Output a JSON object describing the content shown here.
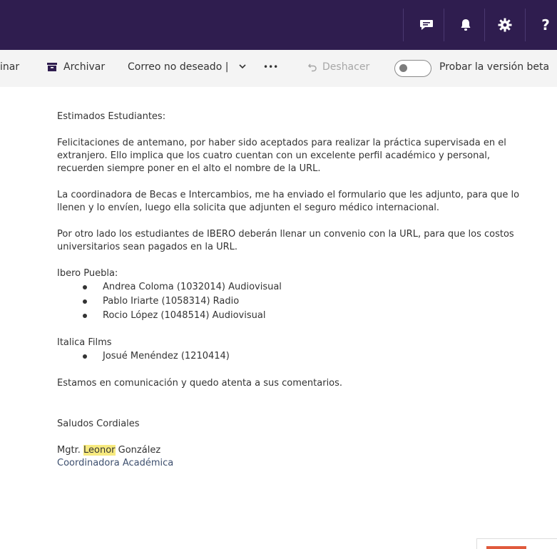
{
  "topbar": {
    "icons": [
      {
        "name": "feedback-icon"
      },
      {
        "name": "bell-icon"
      },
      {
        "name": "gear-icon"
      },
      {
        "name": "help-icon",
        "glyph": "?"
      }
    ],
    "colors": {
      "background": "#2f1d4f"
    }
  },
  "toolbar": {
    "partial_delete": "inar",
    "archive": "Archivar",
    "junk": "Correo no deseado |",
    "more": "•••",
    "undo": "Deshacer",
    "beta": "Probar la versión beta"
  },
  "email": {
    "greeting": "Estimados Estudiantes:",
    "paragraph1": "Felicitaciones de antemano, por haber sido aceptados para realizar la práctica supervisada en el extranjero. Ello implica que los cuatro cuentan con un excelente perfil académico y personal, recuerden siempre poner en el alto el nombre de la URL.",
    "paragraph2": "La coordinadora de Becas e Intercambios, me ha enviado el formulario que les adjunto, para que lo llenen y lo envíen, luego ella solicita que adjunten el seguro médico internacional.",
    "paragraph3": "Por otro lado los estudiantes de IBERO deberán llenar un convenio con la URL, para que los costos universitarios sean pagados en la URL.",
    "group1_title": "Ibero Puebla:",
    "group1_items": [
      "Andrea Coloma (1032014) Audiovisual",
      "Pablo Iriarte (1058314) Radio",
      "Rocio López (1048514) Audiovisual"
    ],
    "group2_title": "Italica Films",
    "group2_items": [
      "Josué Menéndez (1210414)"
    ],
    "closing": "Estamos en comunicación y quedo atenta a sus comentarios.",
    "regards": "Saludos Cordiales",
    "signature_prefix": "Mgtr.",
    "signature_highlight": "Leonor",
    "signature_surname": "González",
    "signature_role": "Coordinadora Académica"
  }
}
